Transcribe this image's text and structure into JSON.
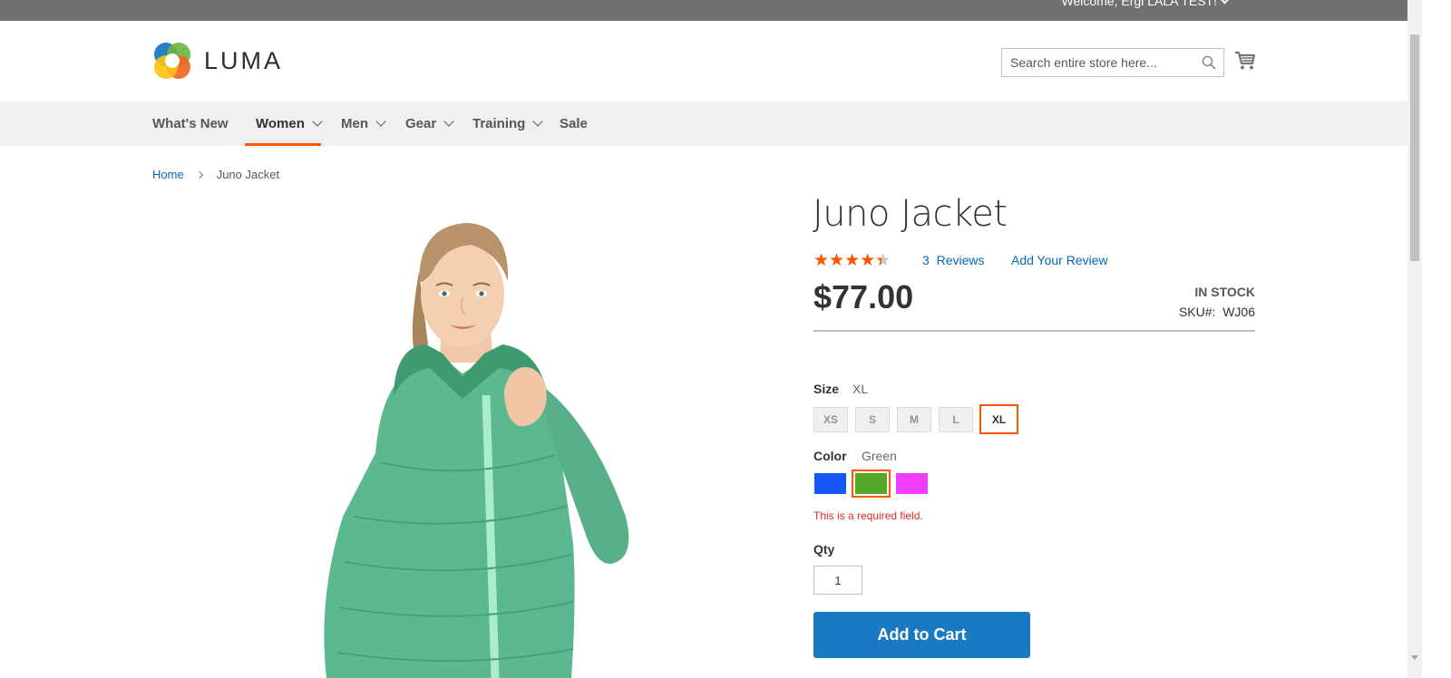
{
  "topbar": {
    "welcome_text": "Welcome, Ergi LALA TEST!"
  },
  "header": {
    "logo_text": "LUMA",
    "search_placeholder": "Search entire store here..."
  },
  "nav": {
    "items": [
      {
        "label": "What's New",
        "dropdown": false,
        "active": false
      },
      {
        "label": "Women",
        "dropdown": true,
        "active": true
      },
      {
        "label": "Men",
        "dropdown": true,
        "active": false
      },
      {
        "label": "Gear",
        "dropdown": true,
        "active": false
      },
      {
        "label": "Training",
        "dropdown": true,
        "active": false
      },
      {
        "label": "Sale",
        "dropdown": false,
        "active": false
      }
    ]
  },
  "breadcrumb": {
    "home": "Home",
    "current": "Juno Jacket"
  },
  "product": {
    "title": "Juno Jacket",
    "rating_fraction": 0.85,
    "reviews_count": "3",
    "reviews_label": "Reviews",
    "add_review": "Add Your Review",
    "price": "$77.00",
    "stock": "In stock",
    "sku_label": "SKU#:",
    "sku_value": "WJ06",
    "image_color": "#5cb88f"
  },
  "options": {
    "size_label": "Size",
    "size_selected": "XL",
    "sizes": [
      "XS",
      "S",
      "M",
      "L",
      "XL"
    ],
    "color_label": "Color",
    "color_selected": "Green",
    "colors": [
      {
        "name": "Blue",
        "hex": "#1857f7"
      },
      {
        "name": "Green",
        "hex": "#53a828"
      },
      {
        "name": "Purple",
        "hex": "#ef3dff"
      }
    ],
    "error": "This is a required field.",
    "qty_label": "Qty",
    "qty_value": "1"
  },
  "actions": {
    "add_to_cart": "Add to Cart"
  },
  "colors": {
    "accent": "#ff5501",
    "link": "#006bb4",
    "button": "#1979c3"
  }
}
